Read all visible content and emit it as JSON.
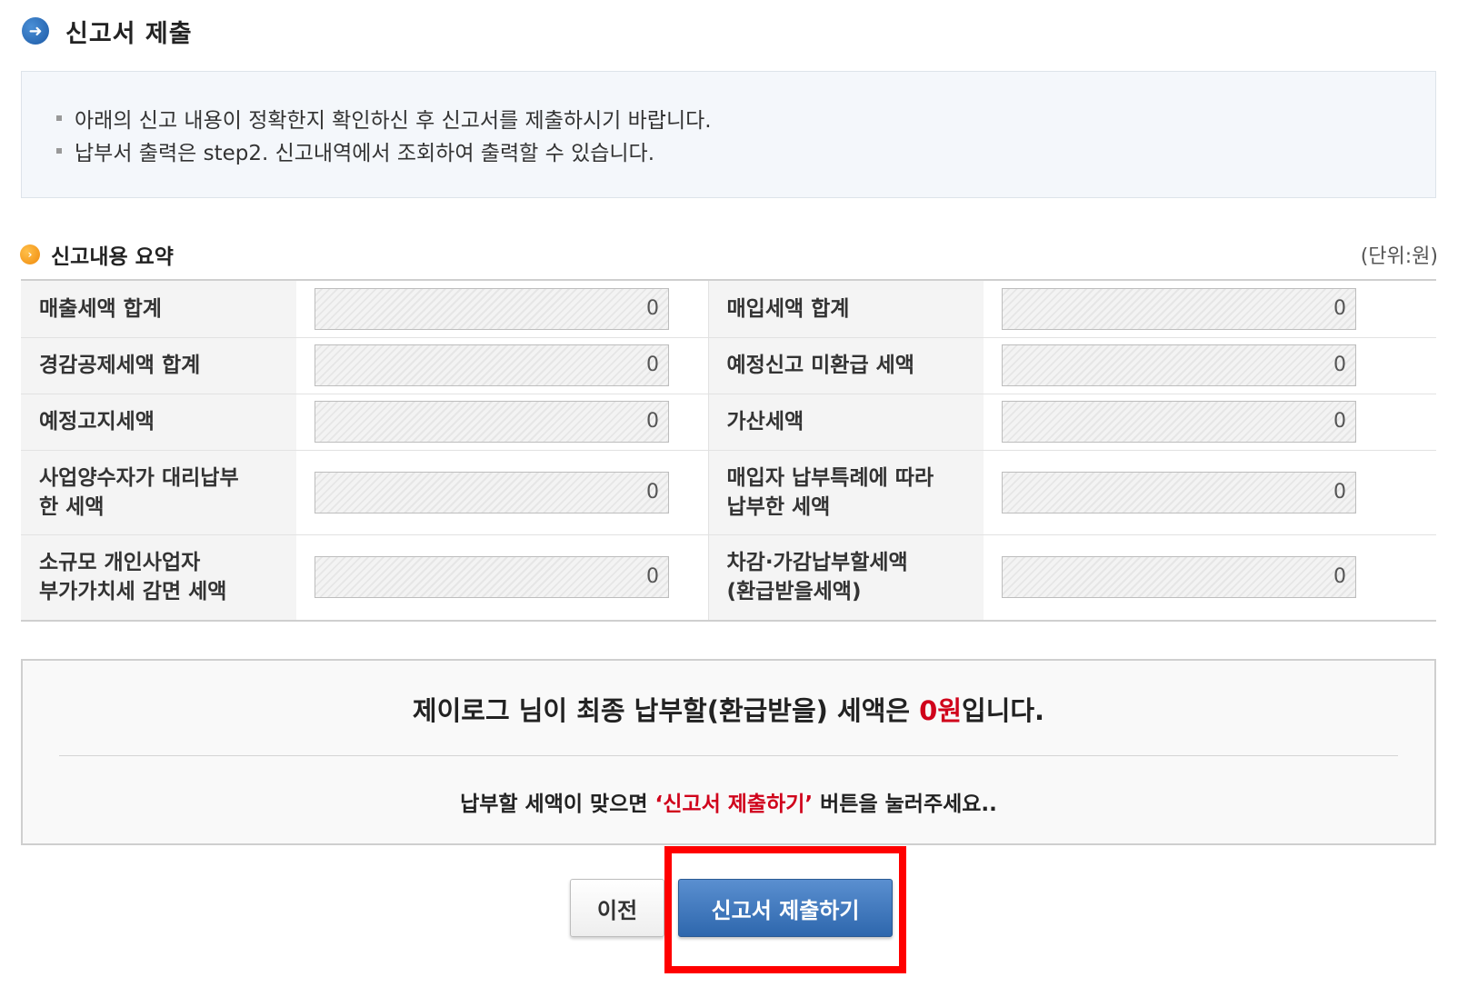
{
  "header": {
    "title": "신고서 제출",
    "icon": "arrow-right-circle-icon"
  },
  "notice": {
    "lines": [
      "아래의 신고 내용이 정확한지 확인하신 후 신고서를 제출하시기 바랍니다.",
      "납부서 출력은 step2. 신고내역에서 조회하여 출력할 수 있습니다."
    ]
  },
  "summary": {
    "title": "신고내용 요약",
    "unit": "(단위:원)",
    "rows": [
      {
        "left_label": "매출세액 합계",
        "left_value": "0",
        "right_label": "매입세액 합계",
        "right_value": "0"
      },
      {
        "left_label": "경감공제세액 합계",
        "left_value": "0",
        "right_label": "예정신고 미환급 세액",
        "right_value": "0"
      },
      {
        "left_label": "예정고지세액",
        "left_value": "0",
        "right_label": "가산세액",
        "right_value": "0"
      },
      {
        "left_label": "사업양수자가 대리납부\n한 세액",
        "left_value": "0",
        "right_label": "매입자 납부특례에 따라\n납부한 세액",
        "right_value": "0"
      },
      {
        "left_label": "소규모 개인사업자\n부가가치세 감면 세액",
        "left_value": "0",
        "right_label": "차감·가감납부할세액\n(환급받을세액)",
        "right_value": "0"
      }
    ]
  },
  "result": {
    "main_prefix": "제이로그 님이 최종 납부할(환급받을) 세액은 ",
    "amount": "0원",
    "main_suffix": "입니다.",
    "sub_prefix": "납부할 세액이 맞으면 ",
    "sub_highlight": "‘신고서 제출하기’",
    "sub_suffix": " 버튼을 눌러주세요.."
  },
  "buttons": {
    "prev_label": "이전",
    "submit_label": "신고서 제출하기"
  },
  "colors": {
    "accent_blue": "#2e67ad",
    "highlight_red": "#ff0000",
    "amount_red": "#d0021b"
  }
}
